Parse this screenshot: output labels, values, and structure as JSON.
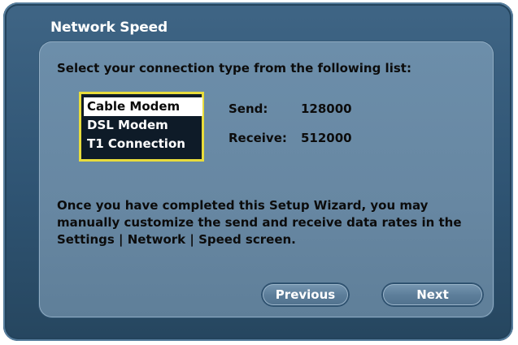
{
  "dialog": {
    "title": "Network Speed",
    "instruction": "Select your connection type from the following list:",
    "connection_types": [
      "Cable Modem",
      "DSL Modem",
      "T1 Connection"
    ],
    "selected_connection": "Cable Modem",
    "send_label": "Send:",
    "send_value": "128000",
    "receive_label": "Receive:",
    "receive_value": "512000",
    "note": "Once you have completed this Setup Wizard, you may manually customize the send and receive data rates in the Settings | Network | Speed screen.",
    "previous_label": "Previous",
    "next_label": "Next"
  },
  "colors": {
    "frame": "#2f5473",
    "panel": "#6787a2",
    "list_focus_border": "#e8dc3c",
    "list_background": "#0e1b28"
  }
}
